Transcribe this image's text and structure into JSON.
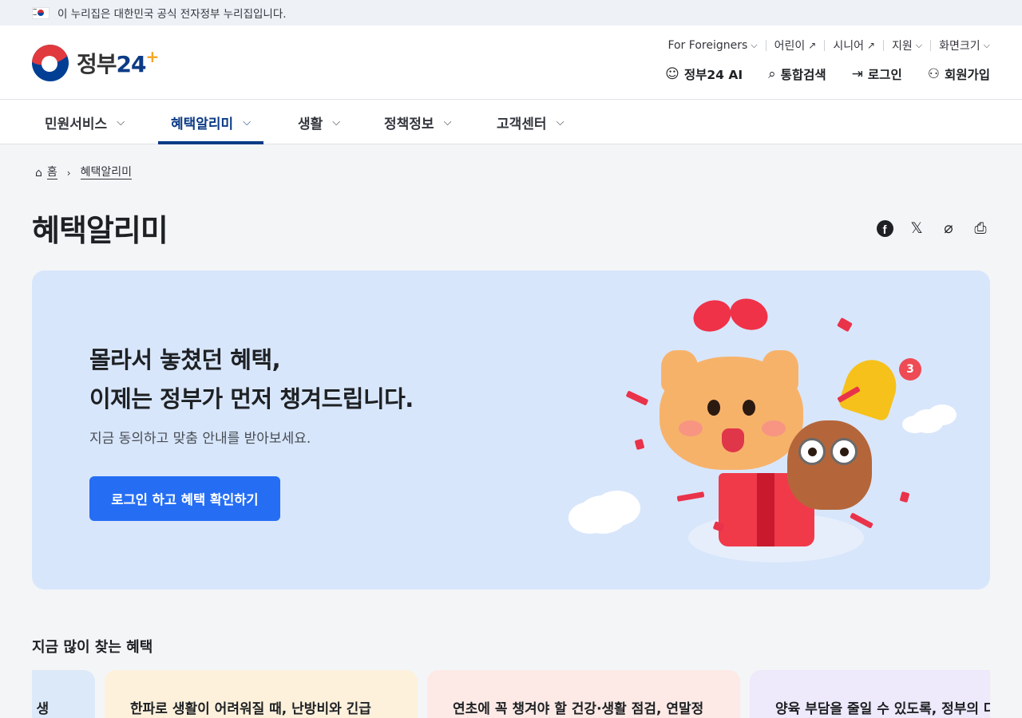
{
  "govbar": {
    "text": "이 누리집은 대한민국 공식 전자정부 누리집입니다."
  },
  "logo": {
    "text_main": "정부",
    "text_num": "24"
  },
  "util": [
    {
      "label": "For Foreigners",
      "type": "dropdown"
    },
    {
      "label": "어린이",
      "type": "external"
    },
    {
      "label": "시니어",
      "type": "external"
    },
    {
      "label": "지원",
      "type": "dropdown"
    },
    {
      "label": "화면크기",
      "type": "dropdown"
    }
  ],
  "actions": {
    "ai": "정부24 AI",
    "search": "통합검색",
    "login": "로그인",
    "signup": "회원가입"
  },
  "nav": [
    {
      "label": "민원서비스",
      "active": false
    },
    {
      "label": "혜택알리미",
      "active": true
    },
    {
      "label": "생활",
      "active": false
    },
    {
      "label": "정책정보",
      "active": false
    },
    {
      "label": "고객센터",
      "active": false
    }
  ],
  "breadcrumb": {
    "home": "홈",
    "current": "혜택알리미"
  },
  "page_title": "혜택알리미",
  "hero": {
    "line1": "몰라서 놓쳤던 혜택,",
    "line2": "이제는 정부가 먼저 챙겨드립니다.",
    "sub": "지금 동의하고 맞춤 안내를 받아보세요.",
    "button": "로그인 하고 혜택 확인하기",
    "bell_badge": "3"
  },
  "popular": {
    "title": "지금 많이 찾는 혜택",
    "cards": [
      {
        "text": "한 생",
        "bg": "#dce9f8"
      },
      {
        "text": "한파로 생활이 어려워질 때, 난방비와 긴급",
        "bg": "#fdf1dc"
      },
      {
        "text": "연초에 꼭 챙겨야 할 건강·생활 점검, 연말정",
        "bg": "#fdeae6"
      },
      {
        "text": "양육 부담을 줄일 수 있도록, 정부의 다",
        "bg": "#eee9fb"
      }
    ]
  },
  "colors": {
    "primary": "#256ef4",
    "brand_navy": "#0b3b85",
    "hero_bg": "#d8e6fb"
  }
}
